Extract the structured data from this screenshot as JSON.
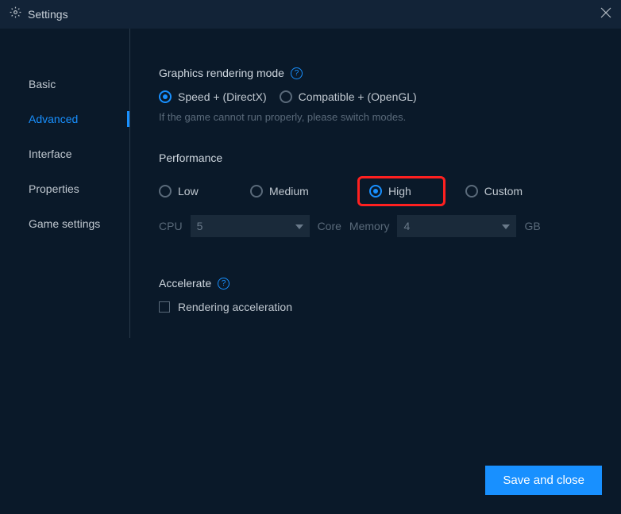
{
  "titlebar": {
    "title": "Settings"
  },
  "sidebar": {
    "items": [
      {
        "label": "Basic"
      },
      {
        "label": "Advanced"
      },
      {
        "label": "Interface"
      },
      {
        "label": "Properties"
      },
      {
        "label": "Game settings"
      }
    ]
  },
  "graphics": {
    "title": "Graphics rendering mode",
    "options": [
      {
        "label": "Speed + (DirectX)"
      },
      {
        "label": "Compatible + (OpenGL)"
      }
    ],
    "hint": "If the game cannot run properly, please switch modes."
  },
  "performance": {
    "title": "Performance",
    "options": [
      {
        "label": "Low"
      },
      {
        "label": "Medium"
      },
      {
        "label": "High"
      },
      {
        "label": "Custom"
      }
    ],
    "cpu_label": "CPU",
    "cpu_value": "5",
    "cpu_unit": "Core",
    "memory_label": "Memory",
    "memory_value": "4",
    "memory_unit": "GB"
  },
  "accelerate": {
    "title": "Accelerate",
    "checkbox_label": "Rendering acceleration"
  },
  "footer": {
    "save_label": "Save and close"
  }
}
